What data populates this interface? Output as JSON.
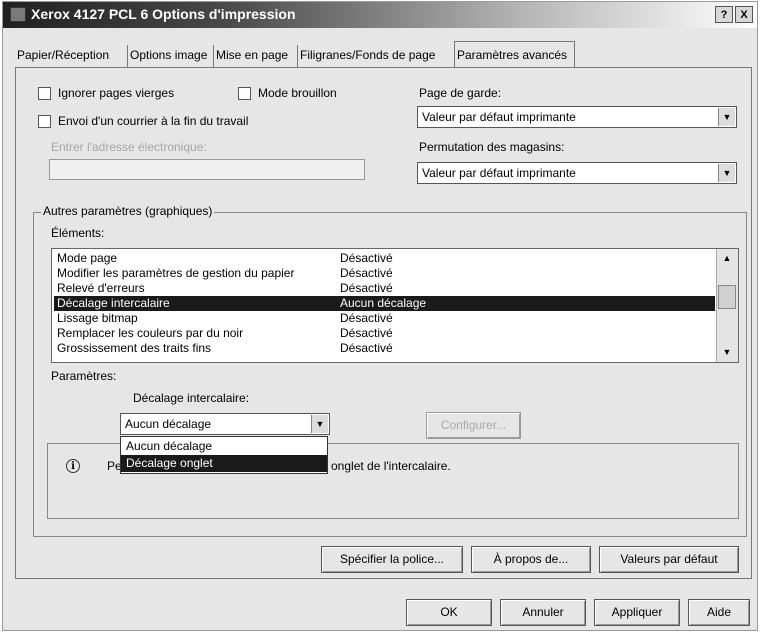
{
  "window": {
    "title": "Xerox 4127 PCL 6 Options d'impression",
    "help_button": "?",
    "close_button": "X"
  },
  "tabs": [
    {
      "label": "Papier/Réception"
    },
    {
      "label": "Options image"
    },
    {
      "label": "Mise en page"
    },
    {
      "label": "Filigranes/Fonds de page"
    },
    {
      "label": "Paramètres avancés",
      "active": true
    }
  ],
  "options": {
    "ignore_blank": "Ignorer pages vierges",
    "draft_mode": "Mode brouillon",
    "send_mail": "Envoi d'un courrier à la fin du travail",
    "email_label": "Entrer l'adresse électronique:",
    "email_value": ""
  },
  "cover_page": {
    "label": "Page de garde:",
    "value": "Valeur par défaut imprimante"
  },
  "tray_switch": {
    "label": "Permutation des magasins:",
    "value": "Valeur par défaut imprimante"
  },
  "group": {
    "legend": "Autres paramètres (graphiques)",
    "elements_label": "Éléments:",
    "items": [
      {
        "name": "Mode page",
        "value": "Désactivé"
      },
      {
        "name": "Modifier les paramètres de gestion du papier",
        "value": "Désactivé"
      },
      {
        "name": "Relevé d'erreurs",
        "value": "Désactivé"
      },
      {
        "name": "Décalage intercalaire",
        "value": "Aucun décalage",
        "selected": true
      },
      {
        "name": "Lissage bitmap",
        "value": "Désactivé"
      },
      {
        "name": "Remplacer les couleurs par du noir",
        "value": "Désactivé"
      },
      {
        "name": "Grossissement des traits fins",
        "value": "Désactivé"
      }
    ],
    "params_label": "Paramètres:",
    "offset_label": "Décalage intercalaire:",
    "offset_value": "Aucun décalage",
    "configure": "Configurer...",
    "dropdown_options": [
      "Aucun décalage",
      "Décalage onglet"
    ],
    "info_text_left": "Per",
    "info_text_right": "onglet de l'intercalaire."
  },
  "buttons": {
    "font": "Spécifier la police...",
    "about": "À propos de...",
    "defaults": "Valeurs par défaut",
    "ok": "OK",
    "cancel": "Annuler",
    "apply": "Appliquer",
    "help": "Aide"
  }
}
